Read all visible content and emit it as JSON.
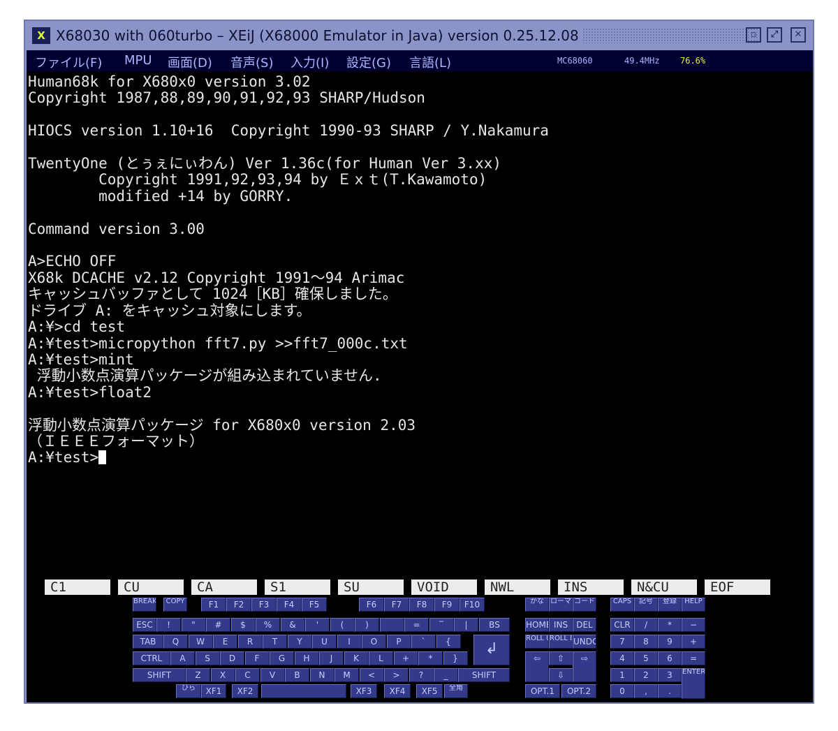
{
  "window": {
    "title": "X68030 with 060turbo – XEiJ (X68000 Emulator in Java) version 0.25.12.08",
    "logo_icon": "xeij-logo-icon"
  },
  "menu": {
    "items": [
      "ファイル(F)",
      "MPU",
      "画面(D)",
      "音声(S)",
      "入力(I)",
      "設定(G)",
      "言語(L)"
    ],
    "status": {
      "cpu": "MC68060",
      "freq": "49.4MHz",
      "load": "76.6%"
    }
  },
  "console": {
    "lines": [
      "Human68k for X680x0 version 3.02",
      "Copyright 1987,88,89,90,91,92,93 SHARP/Hudson",
      "",
      "HIOCS version 1.10+16  Copyright 1990-93 SHARP / Y.Nakamura",
      "",
      "TwentyOne (とぅぇにぃわん) Ver 1.36c(for Human Ver 3.xx)",
      "        Copyright 1991,92,93,94 by Ｅｘｔ(T.Kawamoto)",
      "        modified +14 by GORRY.",
      "",
      "Command version 3.00",
      "",
      "A>ECHO OFF",
      "X68k DCACHE v2.12 Copyright 1991～94 Arimac",
      "キャッシュバッファとして 1024［KB］確保しました。",
      "ドライブ A: をキャッシュ対象にします。",
      "A:¥>cd test",
      "A:¥test>micropython fft7.py >>fft7_000c.txt",
      "A:¥test>mint",
      " 浮動小数点演算パッケージが組み込まれていません.",
      "A:¥test>float2",
      "",
      "浮動小数点演算パッケージ for X680x0 version 2.03",
      "（ＩＥＥＥフォーマット）"
    ],
    "prompt": "A:¥test>"
  },
  "function_keys": [
    "C1",
    "CU",
    "CA",
    "S1",
    "SU",
    "VOID",
    "NWL",
    "INS",
    "N&CU",
    "EOF"
  ],
  "keyboard": {
    "top": [
      "BREAK",
      "COPY"
    ],
    "f": [
      "F1",
      "F2",
      "F3",
      "F4",
      "F5",
      "F6",
      "F7",
      "F8",
      "F9",
      "F10"
    ],
    "mode": [
      "かな",
      "ローマ",
      "コード",
      "CAPS",
      "記号",
      "登録",
      "HELP"
    ],
    "row1": [
      "ESC",
      "!",
      "\"",
      "#",
      "$",
      "%",
      "&",
      "'",
      "(",
      ")",
      "",
      "=",
      "‾",
      "|",
      "BS"
    ],
    "row2": [
      "TAB",
      "Q",
      "W",
      "E",
      "R",
      "T",
      "Y",
      "U",
      "I",
      "O",
      "P",
      "`",
      "{"
    ],
    "row3": [
      "CTRL",
      "A",
      "S",
      "D",
      "F",
      "G",
      "H",
      "J",
      "K",
      "L",
      "+",
      "*",
      "}"
    ],
    "row4": [
      "SHIFT",
      "Z",
      "X",
      "C",
      "V",
      "B",
      "N",
      "M",
      "<",
      ">",
      "?",
      "_",
      "SHIFT"
    ],
    "row5": [
      "ひら",
      "XF1",
      "XF2",
      "",
      "XF3",
      "XF4",
      "XF5",
      "全角"
    ],
    "return_key": "↲",
    "edit": [
      "HOME",
      "INS",
      "DEL",
      "ROLL UP",
      "ROLL DOWN",
      "UNDO",
      "⇦",
      "⇧",
      "⇨",
      "⇩"
    ],
    "opt": [
      "OPT.1",
      "OPT.2"
    ],
    "numpad": [
      "CLR",
      "/",
      "*",
      "−",
      "7",
      "8",
      "9",
      "+",
      "4",
      "5",
      "6",
      "=",
      "1",
      "2",
      "3",
      "ENTER",
      "0",
      ",",
      "."
    ]
  }
}
